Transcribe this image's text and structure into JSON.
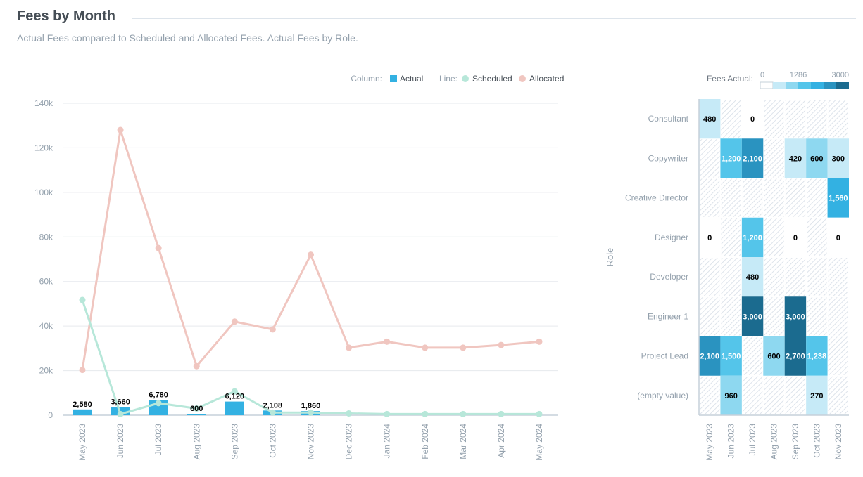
{
  "header": {
    "title": "Fees by Month",
    "subtitle": "Actual Fees compared to Scheduled and Allocated Fees. Actual Fees by Role."
  },
  "colors": {
    "actual": "#33b1e2",
    "scheduled": "#b7e7d9",
    "allocated": "#f0c6c0",
    "axis_text": "#94a1ad",
    "grid": "#e6e9ed",
    "hatch": "#d5dde6",
    "heat_scale": [
      "#ffffff",
      "#c6eaf7",
      "#8ed8f0",
      "#54c5ea",
      "#33b1e2",
      "#2a93c0",
      "#1b6b8f"
    ]
  },
  "chart_data": [
    {
      "type": "bar+line",
      "title": "Fees by Month",
      "legend": {
        "column_label": "Column:",
        "line_label": "Line:",
        "placement": "top-right",
        "items": [
          {
            "group": "column",
            "name": "Actual"
          },
          {
            "group": "line",
            "name": "Scheduled"
          },
          {
            "group": "line",
            "name": "Allocated"
          }
        ]
      },
      "xlabel": "",
      "ylabel": "",
      "ylim": [
        0,
        140000
      ],
      "yticks": [
        0,
        20000,
        40000,
        60000,
        80000,
        100000,
        120000,
        140000
      ],
      "ytick_labels": [
        "0",
        "20k",
        "40k",
        "60k",
        "80k",
        "100k",
        "120k",
        "140k"
      ],
      "grid": true,
      "categories": [
        "May 2023",
        "Jun 2023",
        "Jul 2023",
        "Aug 2023",
        "Sep 2023",
        "Oct 2023",
        "Nov 2023",
        "Dec 2023",
        "Jan 2024",
        "Feb 2024",
        "Mar 2024",
        "Apr 2024",
        "May 2024"
      ],
      "series": [
        {
          "name": "Actual",
          "kind": "column",
          "values": [
            2580,
            3660,
            6780,
            600,
            6120,
            2108,
            1860,
            null,
            null,
            null,
            null,
            null,
            null
          ],
          "labels": [
            "2,580",
            "3,660",
            "6,780",
            "600",
            "6,120",
            "2,108",
            "1,860",
            "",
            "",
            "",
            "",
            "",
            ""
          ]
        },
        {
          "name": "Scheduled",
          "kind": "line",
          "values": [
            51700,
            500,
            5400,
            3000,
            10700,
            1200,
            1200,
            800,
            500,
            500,
            500,
            500,
            500
          ]
        },
        {
          "name": "Allocated",
          "kind": "line",
          "values": [
            20300,
            128000,
            75000,
            22000,
            42000,
            38500,
            72000,
            30300,
            33000,
            30300,
            30300,
            31500,
            33000
          ]
        }
      ]
    },
    {
      "type": "heatmap",
      "title": "",
      "legend": {
        "label": "Fees Actual:",
        "ticks": [
          "0",
          "1286",
          "3000"
        ],
        "placement": "top-right"
      },
      "xlabel": "",
      "ylabel": "Role",
      "x": [
        "May 2023",
        "Jun 2023",
        "Jul 2023",
        "Aug 2023",
        "Sep 2023",
        "Oct 2023",
        "Nov 2023"
      ],
      "y": [
        "Consultant",
        "Copywriter",
        "Creative Director",
        "Designer",
        "Developer",
        "Engineer 1",
        "Project Lead",
        "(empty value)"
      ],
      "range": [
        0,
        3000
      ],
      "values": [
        [
          480,
          null,
          0,
          null,
          null,
          null,
          null
        ],
        [
          null,
          1200,
          2100,
          null,
          420,
          600,
          300
        ],
        [
          null,
          null,
          null,
          null,
          null,
          null,
          1560
        ],
        [
          0,
          null,
          1200,
          null,
          0,
          null,
          0
        ],
        [
          null,
          null,
          480,
          null,
          null,
          null,
          null
        ],
        [
          null,
          null,
          3000,
          null,
          3000,
          null,
          null
        ],
        [
          2100,
          1500,
          null,
          600,
          2700,
          1238,
          null
        ],
        [
          null,
          960,
          null,
          null,
          null,
          270,
          null
        ]
      ],
      "labels": [
        [
          "480",
          "",
          "0",
          "",
          "",
          "",
          ""
        ],
        [
          "",
          "1,200",
          "2,100",
          "",
          "420",
          "600",
          "300"
        ],
        [
          "",
          "",
          "",
          "",
          "",
          "",
          "1,560"
        ],
        [
          "0",
          "",
          "1,200",
          "",
          "0",
          "",
          "0"
        ],
        [
          "",
          "",
          "480",
          "",
          "",
          "",
          ""
        ],
        [
          "",
          "",
          "3,000",
          "",
          "3,000",
          "",
          ""
        ],
        [
          "2,100",
          "1,500",
          "",
          "600",
          "2,700",
          "1,238",
          ""
        ],
        [
          "",
          "960",
          "",
          "",
          "",
          "270",
          ""
        ]
      ]
    }
  ]
}
